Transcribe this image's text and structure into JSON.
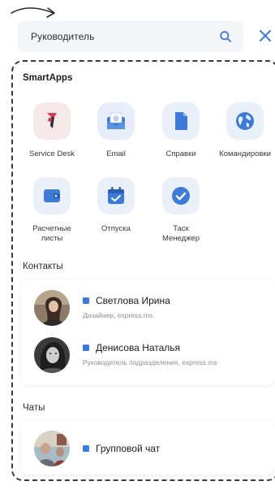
{
  "search": {
    "value": "Руководитель"
  },
  "smartapps": {
    "title": "SmartApps",
    "apps": [
      {
        "label": "Service Desk",
        "icon": "service-desk-icon"
      },
      {
        "label": "Email",
        "icon": "email-icon"
      },
      {
        "label": "Справки",
        "icon": "document-icon"
      },
      {
        "label": "Командировки",
        "icon": "globe-icon"
      },
      {
        "label_line1": "Расчетные",
        "label_line2": "листы",
        "icon": "wallet-icon"
      },
      {
        "label": "Отпуска",
        "icon": "calendar-icon"
      },
      {
        "label_line1": "Таск",
        "label_line2": "Менеджер",
        "icon": "task-check-icon"
      }
    ]
  },
  "contacts": {
    "title": "Контакты",
    "items": [
      {
        "name": "Светлова Ирина",
        "role": "Дизайнер, express.ms"
      },
      {
        "name": "Денисова Наталья",
        "role": "Руководитель подразделения, express.ms"
      }
    ]
  },
  "chats": {
    "title": "Чаты",
    "items": [
      {
        "name": "Групповой чат"
      }
    ]
  },
  "colors": {
    "accent": "#3e7bd8",
    "frame": "#3a3a3a"
  }
}
